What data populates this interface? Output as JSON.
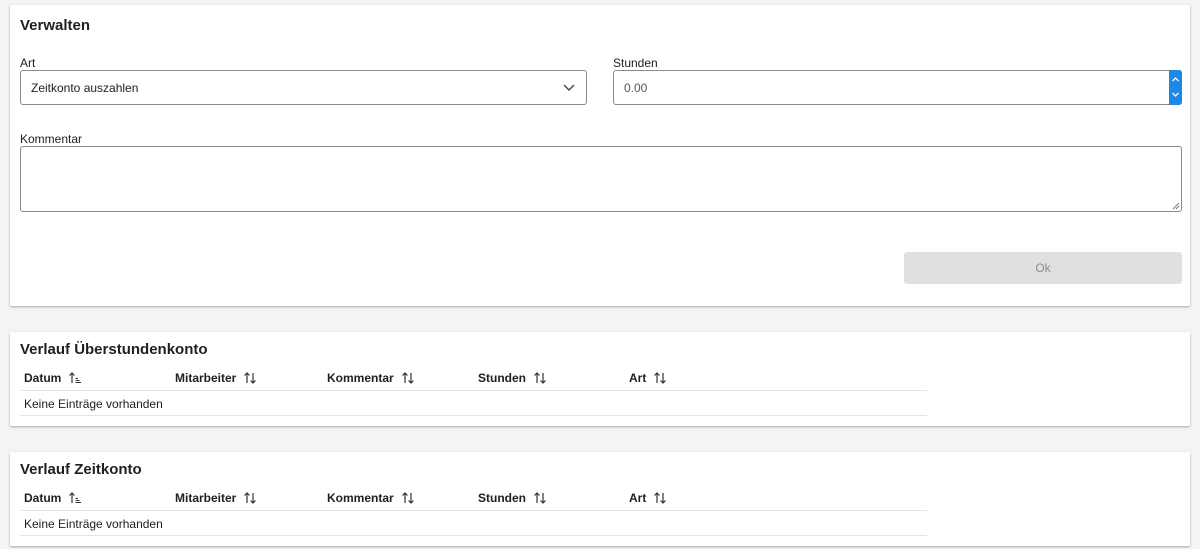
{
  "manage": {
    "title": "Verwalten",
    "type_label": "Art",
    "type_value": "Zeitkonto auszahlen",
    "hours_label": "Stunden",
    "hours_value": "0.00",
    "comment_label": "Kommentar",
    "comment_value": "",
    "ok_label": "Ok"
  },
  "overtime_history": {
    "title": "Verlauf Überstundenkonto",
    "columns": [
      "Datum",
      "Mitarbeiter",
      "Kommentar",
      "Stunden",
      "Art"
    ],
    "empty_text": "Keine Einträge vorhanden"
  },
  "timeaccount_history": {
    "title": "Verlauf Zeitkonto",
    "columns": [
      "Datum",
      "Mitarbeiter",
      "Kommentar",
      "Stunden",
      "Art"
    ],
    "empty_text": "Keine Einträge vorhanden"
  },
  "icons": {
    "select_arrow": "chevron-down-icon",
    "sort_active": "sort-ascending-icon",
    "sort_inactive": "sort-both-icon"
  },
  "colors": {
    "accent": "#1e88e5",
    "disabled_button": "#e0e0e0",
    "disabled_text": "#8a8a8a"
  }
}
